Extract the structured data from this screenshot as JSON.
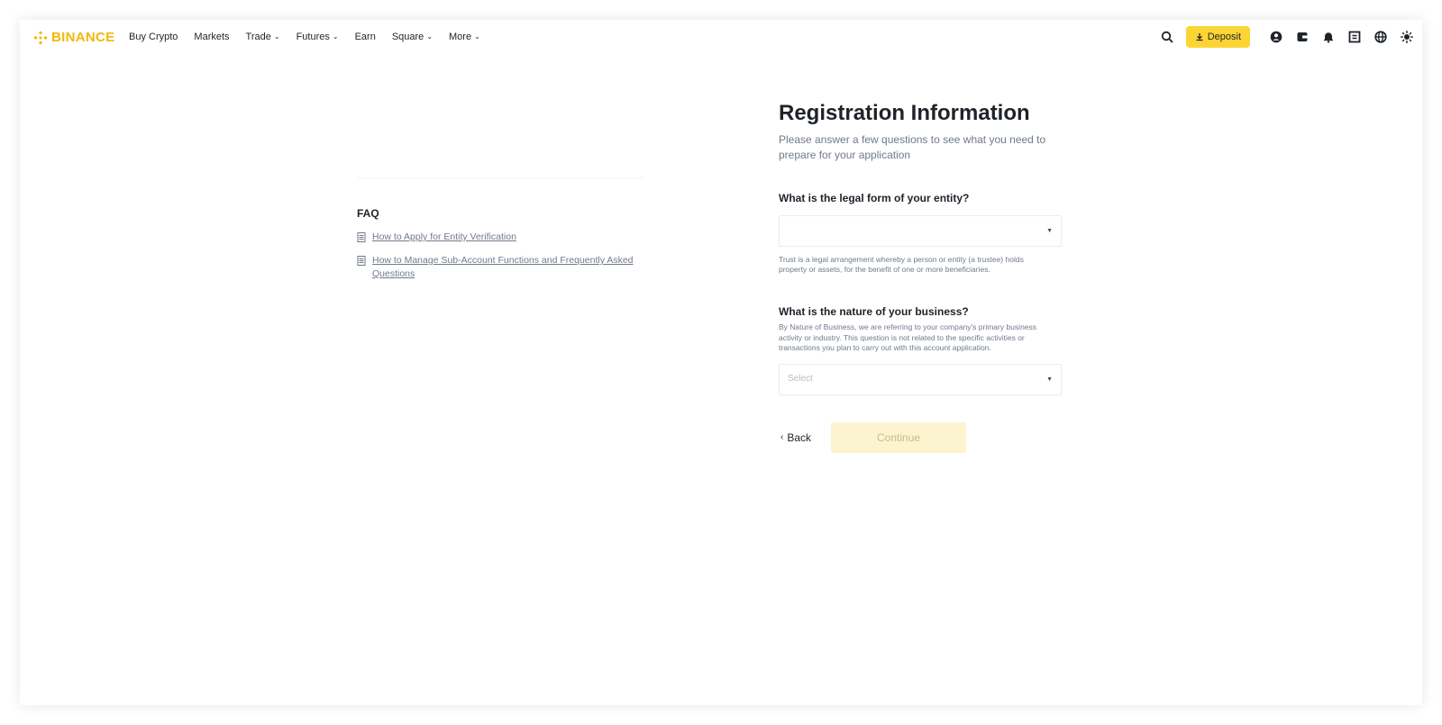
{
  "brand": {
    "name": "BINANCE",
    "color": "#f0b90b"
  },
  "nav": [
    {
      "label": "Buy Crypto",
      "dropdown": false
    },
    {
      "label": "Markets",
      "dropdown": false
    },
    {
      "label": "Trade",
      "dropdown": true
    },
    {
      "label": "Futures",
      "dropdown": true
    },
    {
      "label": "Earn",
      "dropdown": false
    },
    {
      "label": "Square",
      "dropdown": true
    },
    {
      "label": "More",
      "dropdown": true
    }
  ],
  "toolbar": {
    "deposit_label": "Deposit",
    "icons": [
      "search-icon",
      "user-icon",
      "wallet-icon",
      "bell-icon",
      "download-app-icon",
      "globe-icon",
      "theme-icon"
    ]
  },
  "faq": {
    "title": "FAQ",
    "items": [
      "How to Apply for Entity Verification",
      "How to Manage Sub-Account Functions and Frequently Asked Questions"
    ]
  },
  "form": {
    "title": "Registration Information",
    "subtitle": "Please answer a few questions to see what you need to prepare for your application",
    "q1": {
      "label": "What is the legal form of your entity?",
      "value": "",
      "hint": "Trust is a legal arrangement whereby a person or entity (a trustee) holds property or assets, for the benefit of one or more beneficiaries."
    },
    "q2": {
      "label": "What is the nature of your business?",
      "hint": "By Nature of Business, we are referring to your company's primary business activity or industry. This question is not related to the specific activities or transactions you plan to carry out with this account application.",
      "placeholder": "Select"
    },
    "back_label": "Back",
    "continue_label": "Continue"
  },
  "colors": {
    "accent": "#fcd535",
    "disabled_button": "#fcf3cf",
    "text_muted": "#707a8a"
  }
}
